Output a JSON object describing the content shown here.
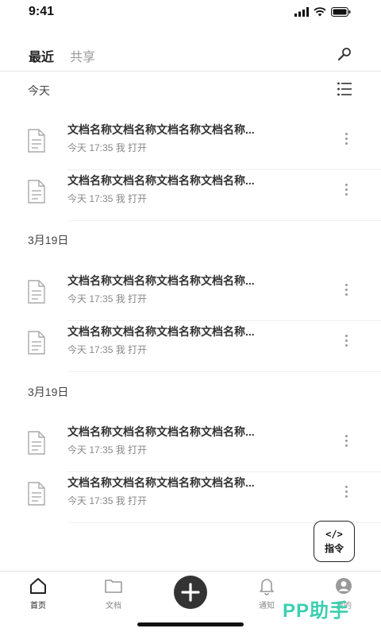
{
  "status_bar": {
    "time": "9:41"
  },
  "top_tabs": {
    "recent": "最近",
    "share": "共享"
  },
  "sections": [
    {
      "label": "今天",
      "items": [
        {
          "title": "文档名称文档名称文档名称文档名称...",
          "meta": "今天 17:35  我 打开"
        },
        {
          "title": "文档名称文档名称文档名称文档名称...",
          "meta": "今天 17:35  我 打开"
        }
      ]
    },
    {
      "label": "3月19日",
      "items": [
        {
          "title": "文档名称文档名称文档名称文档名称...",
          "meta": "今天 17:35  我 打开"
        },
        {
          "title": "文档名称文档名称文档名称文档名称...",
          "meta": "今天 17:35  我 打开"
        }
      ]
    },
    {
      "label": "3月19日",
      "items": [
        {
          "title": "文档名称文档名称文档名称文档名称...",
          "meta": "今天 17:35  我 打开"
        },
        {
          "title": "文档名称文档名称文档名称文档名称...",
          "meta": "今天 17:35  我 打开"
        }
      ]
    }
  ],
  "command_button": {
    "code": "</>",
    "label": "指令"
  },
  "bottom_nav": {
    "home": "首页",
    "docs": "文档",
    "notify": "通知",
    "mine": "我的"
  },
  "watermark": "PP助手",
  "icons": {
    "search": "search-icon",
    "list": "list-view-icon",
    "document": "document-icon",
    "more": "more-vertical-icon",
    "home": "home-icon",
    "folder": "folder-icon",
    "add": "plus-icon",
    "bell": "bell-icon",
    "user": "user-icon"
  },
  "colors": {
    "watermark": "#3ccfb0",
    "fab": "#333333"
  }
}
